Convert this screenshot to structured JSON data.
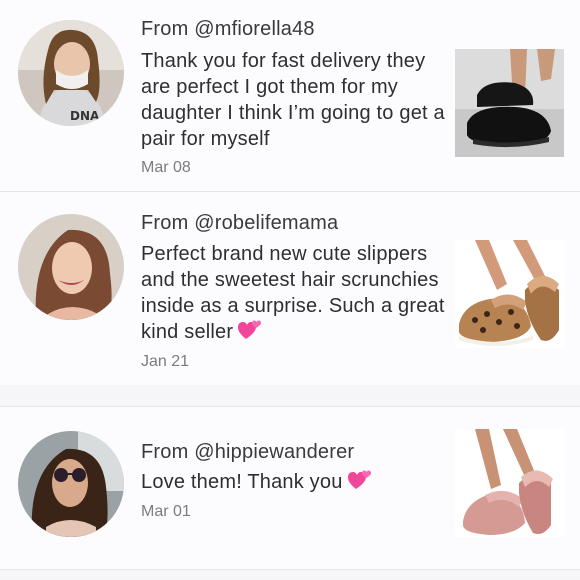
{
  "reviews": [
    {
      "from": "From @mfiorella48",
      "text": "Thank you for fast delivery they are perfect I got them for my daughter I think I’m going to get a pair for myself",
      "date": "Mar 08",
      "avatar_icon": "user-avatar-photo",
      "product_icon": "black-slipper-photo"
    },
    {
      "from": "From @robelifemama",
      "text": "Perfect brand new cute slippers and the sweetest hair scrunchies inside as a surprise. Such a great kind seller",
      "emoji": "two-hearts-emoji",
      "date": "Jan 21",
      "avatar_icon": "user-avatar-photo",
      "product_icon": "leopard-slipper-photo"
    },
    {
      "from": "From @hippiewanderer",
      "text": "Love them! Thank you",
      "emoji": "two-hearts-emoji",
      "date": "Mar 01",
      "avatar_icon": "user-avatar-photo",
      "product_icon": "pink-slipper-photo"
    }
  ],
  "colors": {
    "background": "#f6f5f8",
    "card": "#fcfbfd",
    "text": "#2f2f33",
    "muted": "#7d7b82",
    "heart": "#f0479a"
  }
}
